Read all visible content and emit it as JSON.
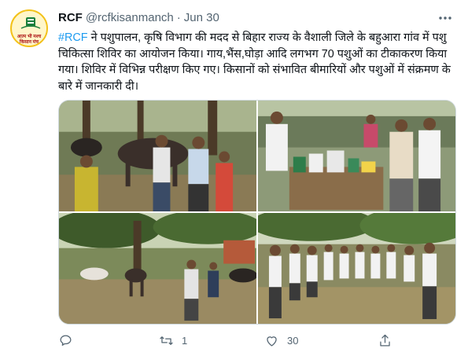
{
  "tweet": {
    "avatar": {
      "icon": "rcf-logo-icon",
      "line1": "आत्म भी मश्च",
      "line2": "किसान मंच"
    },
    "display_name": "RCF",
    "handle": "@rcfkisanmanch",
    "separator": "·",
    "date": "Jun 30",
    "hashtag": "#RCF",
    "body": " ने पशुपालन, कृषि विभाग की मदद से बिहार राज्य के वैशाली जिले के बहुआरा गांव में पशु चिकित्सा शिविर का आयोजन किया। गाय,भैंस,घोड़ा आदि लगभग 70 पशुओं का टीकाकरण किया गया। शिविर में विभिन्न परीक्षण किए गए। किसानों को संभावित बीमारियों और पशुओं में संक्रमण के बारे में जानकारी दी।"
  },
  "media": {
    "photos": [
      {
        "icon": "photo-cattle-vaccination"
      },
      {
        "icon": "photo-medicine-table"
      },
      {
        "icon": "photo-cattle-orchard"
      },
      {
        "icon": "photo-farmers-gathering"
      }
    ]
  },
  "actions": {
    "reply": {
      "icon": "reply-icon",
      "count": ""
    },
    "retweet": {
      "icon": "retweet-icon",
      "count": "1"
    },
    "like": {
      "icon": "heart-icon",
      "count": "30"
    },
    "share": {
      "icon": "share-icon",
      "count": ""
    }
  },
  "colors": {
    "link": "#1d9bf0",
    "secondary_text": "#536471",
    "primary_text": "#0f1419",
    "border": "#cfd9de"
  }
}
